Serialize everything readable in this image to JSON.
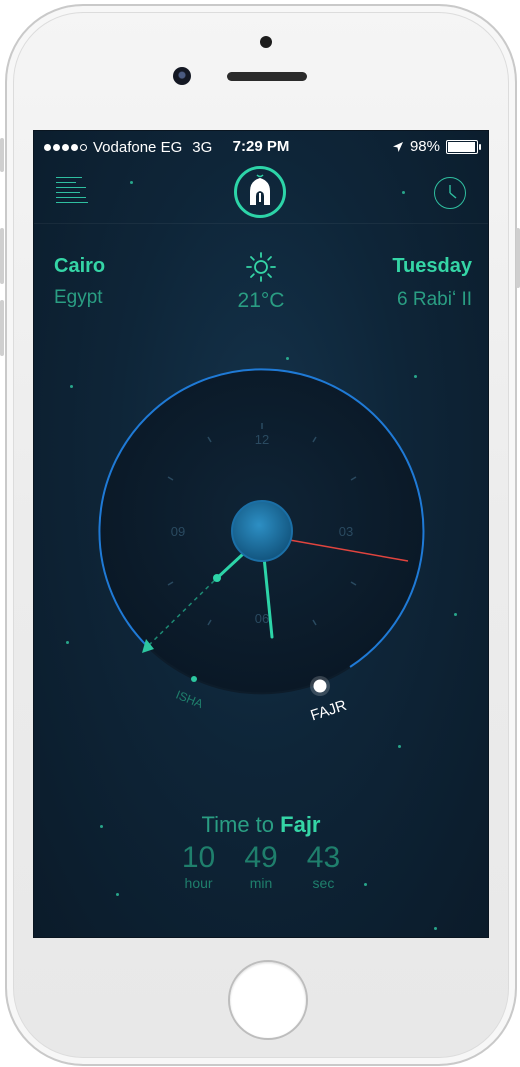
{
  "status": {
    "carrier": "Vodafone EG",
    "network": "3G",
    "time": "7:29 PM",
    "battery": "98%",
    "battery_level": 0.98,
    "signal_bars": 4,
    "signal_total": 5
  },
  "nav": {
    "menu_icon": "menu-lines-icon",
    "logo_icon": "mosque-logo-icon",
    "clock_icon": "clock-icon"
  },
  "location": {
    "city": "Cairo",
    "country": "Egypt"
  },
  "weather": {
    "icon": "sun-icon",
    "temperature": "21°C"
  },
  "date": {
    "day": "Tuesday",
    "hijri": "6 Rabiʻ II"
  },
  "dial": {
    "labels": {
      "top": "12",
      "right": "03",
      "bottom": "06",
      "left": "09"
    },
    "prayers": [
      {
        "name": "ISHA",
        "active": false
      },
      {
        "name": "FAJR",
        "active": true
      }
    ]
  },
  "countdown": {
    "prefix": "Time to",
    "prayer": "Fajr",
    "hours": "10",
    "hours_unit": "hour",
    "minutes": "49",
    "minutes_unit": "min",
    "seconds": "43",
    "seconds_unit": "sec"
  },
  "colors": {
    "accent": "#35d5a6",
    "accent_dim": "#2a9e83",
    "ring": "#1f7ad6",
    "second_hand": "#e0443e",
    "background": "#0e2538"
  }
}
